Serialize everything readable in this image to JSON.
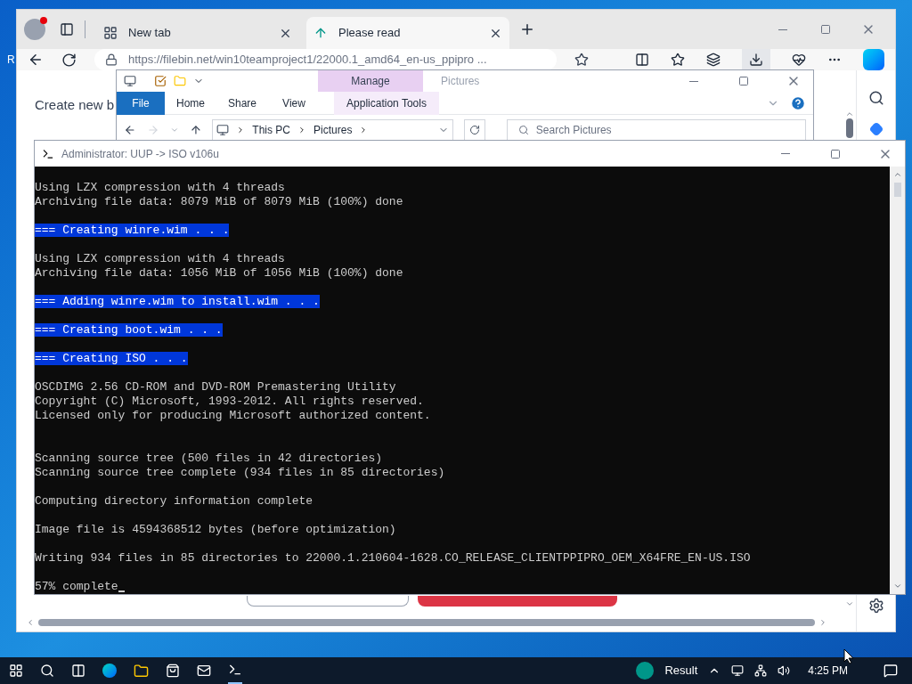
{
  "desktop": {
    "icon_labels": [
      "R"
    ]
  },
  "browser": {
    "tabs": [
      {
        "label": "New tab",
        "selected": false
      },
      {
        "label": "Please read",
        "selected": true
      }
    ],
    "url": "https://filebin.net/win10teamproject1/22000.1_amd64_en-us_ppipro ...",
    "page": {
      "heading": "Create new b"
    }
  },
  "explorer": {
    "context_tab": "Manage",
    "title": "Pictures",
    "ribbon_tabs": [
      {
        "label": "File",
        "kind": "file"
      },
      {
        "label": "Home",
        "kind": "tab"
      },
      {
        "label": "Share",
        "kind": "tab"
      },
      {
        "label": "View",
        "kind": "tab"
      },
      {
        "label": "Application Tools",
        "kind": "context"
      }
    ],
    "breadcrumb": [
      "This PC",
      "Pictures"
    ],
    "search": {
      "placeholder": "Search Pictures"
    }
  },
  "console": {
    "title": "Administrator: UUP -> ISO v106u",
    "lines": [
      {
        "kind": "text",
        "text": "Using LZX compression with 4 threads"
      },
      {
        "kind": "text",
        "text": "Archiving file data: 8079 MiB of 8079 MiB (100%) done"
      },
      {
        "kind": "blank"
      },
      {
        "kind": "highlight",
        "text": "=== Creating winre.wim . . ."
      },
      {
        "kind": "blank"
      },
      {
        "kind": "text",
        "text": "Using LZX compression with 4 threads"
      },
      {
        "kind": "text",
        "text": "Archiving file data: 1056 MiB of 1056 MiB (100%) done"
      },
      {
        "kind": "blank"
      },
      {
        "kind": "highlight",
        "text": "=== Adding winre.wim to install.wim . . ."
      },
      {
        "kind": "blank"
      },
      {
        "kind": "highlight",
        "text": "=== Creating boot.wim . . ."
      },
      {
        "kind": "blank"
      },
      {
        "kind": "highlight",
        "text": "=== Creating ISO . . ."
      },
      {
        "kind": "blank"
      },
      {
        "kind": "text",
        "text": "OSCDIMG 2.56 CD-ROM and DVD-ROM Premastering Utility"
      },
      {
        "kind": "text",
        "text": "Copyright (C) Microsoft, 1993-2012. All rights reserved."
      },
      {
        "kind": "text",
        "text": "Licensed only for producing Microsoft authorized content."
      },
      {
        "kind": "blank"
      },
      {
        "kind": "blank"
      },
      {
        "kind": "text",
        "text": "Scanning source tree (500 files in 42 directories)"
      },
      {
        "kind": "text",
        "text": "Scanning source tree complete (934 files in 85 directories)"
      },
      {
        "kind": "blank"
      },
      {
        "kind": "text",
        "text": "Computing directory information complete"
      },
      {
        "kind": "blank"
      },
      {
        "kind": "text",
        "text": "Image file is 4594368512 bytes (before optimization)"
      },
      {
        "kind": "blank"
      },
      {
        "kind": "text",
        "text": "Writing 934 files in 85 directories to 22000.1.210604-1628.CO_RELEASE_CLIENTPPIPRO_OEM_X64FRE_EN-US.ISO"
      },
      {
        "kind": "blank"
      },
      {
        "kind": "prompt",
        "text": "57% complete"
      }
    ]
  },
  "taskbar": {
    "tray_label": "Result",
    "clock": "4:25 PM"
  }
}
